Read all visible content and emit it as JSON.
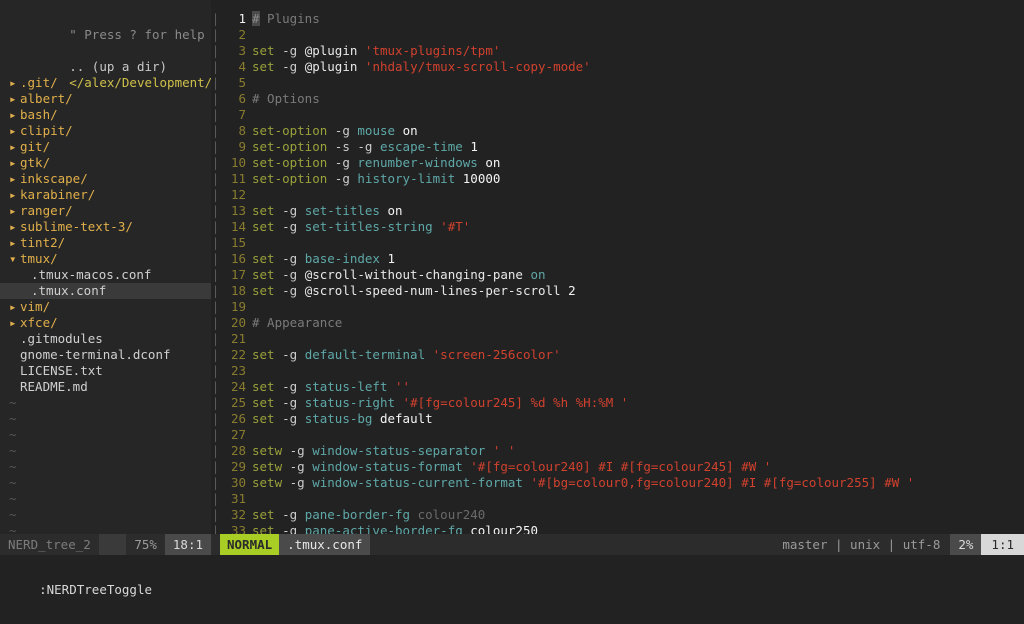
{
  "app": {
    "name": "vim",
    "theme_bg": "#222222",
    "accent": "#a8cd24"
  },
  "sidebar": {
    "name": "NERDTree",
    "help_hint": "\" Press ? for help",
    "up_dir": ".. (up a dir)",
    "cwd": "</alex/Development/dotfiles/",
    "collapsed_icon": "▸",
    "expanded_icon": "▾",
    "items": [
      {
        "label": ".git/",
        "type": "dir",
        "state": "collapsed",
        "indent": 0,
        "selected": false
      },
      {
        "label": "albert/",
        "type": "dir",
        "state": "collapsed",
        "indent": 0,
        "selected": false
      },
      {
        "label": "bash/",
        "type": "dir",
        "state": "collapsed",
        "indent": 0,
        "selected": false
      },
      {
        "label": "clipit/",
        "type": "dir",
        "state": "collapsed",
        "indent": 0,
        "selected": false
      },
      {
        "label": "git/",
        "type": "dir",
        "state": "collapsed",
        "indent": 0,
        "selected": false
      },
      {
        "label": "gtk/",
        "type": "dir",
        "state": "collapsed",
        "indent": 0,
        "selected": false
      },
      {
        "label": "inkscape/",
        "type": "dir",
        "state": "collapsed",
        "indent": 0,
        "selected": false
      },
      {
        "label": "karabiner/",
        "type": "dir",
        "state": "collapsed",
        "indent": 0,
        "selected": false
      },
      {
        "label": "ranger/",
        "type": "dir",
        "state": "collapsed",
        "indent": 0,
        "selected": false
      },
      {
        "label": "sublime-text-3/",
        "type": "dir",
        "state": "collapsed",
        "indent": 0,
        "selected": false
      },
      {
        "label": "tint2/",
        "type": "dir",
        "state": "collapsed",
        "indent": 0,
        "selected": false
      },
      {
        "label": "tmux/",
        "type": "dir",
        "state": "expanded",
        "indent": 0,
        "selected": false
      },
      {
        "label": ".tmux-macos.conf",
        "type": "file",
        "state": "none",
        "indent": 1,
        "selected": false
      },
      {
        "label": ".tmux.conf",
        "type": "file",
        "state": "none",
        "indent": 1,
        "selected": true
      },
      {
        "label": "vim/",
        "type": "dir",
        "state": "collapsed",
        "indent": 0,
        "selected": false
      },
      {
        "label": "xfce/",
        "type": "dir",
        "state": "collapsed",
        "indent": 0,
        "selected": false
      },
      {
        "label": ".gitmodules",
        "type": "file",
        "state": "none",
        "indent": 0,
        "selected": false
      },
      {
        "label": "gnome-terminal.dconf",
        "type": "file",
        "state": "none",
        "indent": 0,
        "selected": false
      },
      {
        "label": "LICENSE.txt",
        "type": "file",
        "state": "none",
        "indent": 0,
        "selected": false
      },
      {
        "label": "README.md",
        "type": "file",
        "state": "none",
        "indent": 0,
        "selected": false
      }
    ],
    "empty_marker": "~",
    "empty_marker_count": 9
  },
  "editor": {
    "filename": ".tmux.conf",
    "cursor_line": 1,
    "lines": [
      {
        "n": 1,
        "tokens": [
          {
            "t": "# Plugins",
            "c": "cmt",
            "cursor": 1
          }
        ]
      },
      {
        "n": 2,
        "tokens": []
      },
      {
        "n": 3,
        "tokens": [
          {
            "t": "set",
            "c": "kw"
          },
          {
            "t": " ",
            "c": "plain"
          },
          {
            "t": "-g",
            "c": "flag"
          },
          {
            "t": " ",
            "c": "plain"
          },
          {
            "t": "@plugin",
            "c": "atvar"
          },
          {
            "t": " ",
            "c": "plain"
          },
          {
            "t": "'tmux-plugins/tpm'",
            "c": "str"
          }
        ]
      },
      {
        "n": 4,
        "tokens": [
          {
            "t": "set",
            "c": "kw"
          },
          {
            "t": " ",
            "c": "plain"
          },
          {
            "t": "-g",
            "c": "flag"
          },
          {
            "t": " ",
            "c": "plain"
          },
          {
            "t": "@plugin",
            "c": "atvar"
          },
          {
            "t": " ",
            "c": "plain"
          },
          {
            "t": "'nhdaly/tmux-scroll-copy-mode'",
            "c": "str"
          }
        ]
      },
      {
        "n": 5,
        "tokens": []
      },
      {
        "n": 6,
        "tokens": [
          {
            "t": "# Options",
            "c": "cmt"
          }
        ]
      },
      {
        "n": 7,
        "tokens": []
      },
      {
        "n": 8,
        "tokens": [
          {
            "t": "set-option",
            "c": "kw"
          },
          {
            "t": " ",
            "c": "plain"
          },
          {
            "t": "-g",
            "c": "flag"
          },
          {
            "t": " ",
            "c": "plain"
          },
          {
            "t": "mouse",
            "c": "opt"
          },
          {
            "t": " ",
            "c": "plain"
          },
          {
            "t": "on",
            "c": "val"
          }
        ]
      },
      {
        "n": 9,
        "tokens": [
          {
            "t": "set-option",
            "c": "kw"
          },
          {
            "t": " ",
            "c": "plain"
          },
          {
            "t": "-s",
            "c": "flag"
          },
          {
            "t": " ",
            "c": "plain"
          },
          {
            "t": "-g",
            "c": "flag"
          },
          {
            "t": " ",
            "c": "plain"
          },
          {
            "t": "escape-time",
            "c": "opt"
          },
          {
            "t": " ",
            "c": "plain"
          },
          {
            "t": "1",
            "c": "val"
          }
        ]
      },
      {
        "n": 10,
        "tokens": [
          {
            "t": "set-option",
            "c": "kw"
          },
          {
            "t": " ",
            "c": "plain"
          },
          {
            "t": "-g",
            "c": "flag"
          },
          {
            "t": " ",
            "c": "plain"
          },
          {
            "t": "renumber-windows",
            "c": "opt"
          },
          {
            "t": " ",
            "c": "plain"
          },
          {
            "t": "on",
            "c": "val"
          }
        ]
      },
      {
        "n": 11,
        "tokens": [
          {
            "t": "set-option",
            "c": "kw"
          },
          {
            "t": " ",
            "c": "plain"
          },
          {
            "t": "-g",
            "c": "flag"
          },
          {
            "t": " ",
            "c": "plain"
          },
          {
            "t": "history-limit",
            "c": "opt"
          },
          {
            "t": " ",
            "c": "plain"
          },
          {
            "t": "10000",
            "c": "val"
          }
        ]
      },
      {
        "n": 12,
        "tokens": []
      },
      {
        "n": 13,
        "tokens": [
          {
            "t": "set",
            "c": "kw"
          },
          {
            "t": " ",
            "c": "plain"
          },
          {
            "t": "-g",
            "c": "flag"
          },
          {
            "t": " ",
            "c": "plain"
          },
          {
            "t": "set-titles",
            "c": "opt"
          },
          {
            "t": " ",
            "c": "plain"
          },
          {
            "t": "on",
            "c": "val"
          }
        ]
      },
      {
        "n": 14,
        "tokens": [
          {
            "t": "set",
            "c": "kw"
          },
          {
            "t": " ",
            "c": "plain"
          },
          {
            "t": "-g",
            "c": "flag"
          },
          {
            "t": " ",
            "c": "plain"
          },
          {
            "t": "set-titles-string",
            "c": "opt"
          },
          {
            "t": " ",
            "c": "plain"
          },
          {
            "t": "'#T'",
            "c": "str"
          }
        ]
      },
      {
        "n": 15,
        "tokens": []
      },
      {
        "n": 16,
        "tokens": [
          {
            "t": "set",
            "c": "kw"
          },
          {
            "t": " ",
            "c": "plain"
          },
          {
            "t": "-g",
            "c": "flag"
          },
          {
            "t": " ",
            "c": "plain"
          },
          {
            "t": "base-index",
            "c": "opt"
          },
          {
            "t": " ",
            "c": "plain"
          },
          {
            "t": "1",
            "c": "val"
          }
        ]
      },
      {
        "n": 17,
        "tokens": [
          {
            "t": "set",
            "c": "kw"
          },
          {
            "t": " ",
            "c": "plain"
          },
          {
            "t": "-g",
            "c": "flag"
          },
          {
            "t": " ",
            "c": "plain"
          },
          {
            "t": "@scroll-without-changing-pane",
            "c": "atvar"
          },
          {
            "t": " ",
            "c": "plain"
          },
          {
            "t": "on",
            "c": "opt"
          }
        ]
      },
      {
        "n": 18,
        "tokens": [
          {
            "t": "set",
            "c": "kw"
          },
          {
            "t": " ",
            "c": "plain"
          },
          {
            "t": "-g",
            "c": "flag"
          },
          {
            "t": " ",
            "c": "plain"
          },
          {
            "t": "@scroll-speed-num-lines-per-scroll",
            "c": "atvar"
          },
          {
            "t": " ",
            "c": "plain"
          },
          {
            "t": "2",
            "c": "val"
          }
        ]
      },
      {
        "n": 19,
        "tokens": []
      },
      {
        "n": 20,
        "tokens": [
          {
            "t": "# Appearance",
            "c": "cmt"
          }
        ]
      },
      {
        "n": 21,
        "tokens": []
      },
      {
        "n": 22,
        "tokens": [
          {
            "t": "set",
            "c": "kw"
          },
          {
            "t": " ",
            "c": "plain"
          },
          {
            "t": "-g",
            "c": "flag"
          },
          {
            "t": " ",
            "c": "plain"
          },
          {
            "t": "default-terminal",
            "c": "opt"
          },
          {
            "t": " ",
            "c": "plain"
          },
          {
            "t": "'screen-256color'",
            "c": "str"
          }
        ]
      },
      {
        "n": 23,
        "tokens": []
      },
      {
        "n": 24,
        "tokens": [
          {
            "t": "set",
            "c": "kw"
          },
          {
            "t": " ",
            "c": "plain"
          },
          {
            "t": "-g",
            "c": "flag"
          },
          {
            "t": " ",
            "c": "plain"
          },
          {
            "t": "status-left",
            "c": "opt"
          },
          {
            "t": " ",
            "c": "plain"
          },
          {
            "t": "''",
            "c": "str"
          }
        ]
      },
      {
        "n": 25,
        "tokens": [
          {
            "t": "set",
            "c": "kw"
          },
          {
            "t": " ",
            "c": "plain"
          },
          {
            "t": "-g",
            "c": "flag"
          },
          {
            "t": " ",
            "c": "plain"
          },
          {
            "t": "status-right",
            "c": "opt"
          },
          {
            "t": " ",
            "c": "plain"
          },
          {
            "t": "'#[fg=colour245] %d %h %H:%M '",
            "c": "str"
          }
        ]
      },
      {
        "n": 26,
        "tokens": [
          {
            "t": "set",
            "c": "kw"
          },
          {
            "t": " ",
            "c": "plain"
          },
          {
            "t": "-g",
            "c": "flag"
          },
          {
            "t": " ",
            "c": "plain"
          },
          {
            "t": "status-bg",
            "c": "opt"
          },
          {
            "t": " ",
            "c": "plain"
          },
          {
            "t": "default",
            "c": "val"
          }
        ]
      },
      {
        "n": 27,
        "tokens": []
      },
      {
        "n": 28,
        "tokens": [
          {
            "t": "setw",
            "c": "kw"
          },
          {
            "t": " ",
            "c": "plain"
          },
          {
            "t": "-g",
            "c": "flag"
          },
          {
            "t": " ",
            "c": "plain"
          },
          {
            "t": "window-status-separator",
            "c": "opt"
          },
          {
            "t": " ",
            "c": "plain"
          },
          {
            "t": "' '",
            "c": "str"
          }
        ]
      },
      {
        "n": 29,
        "tokens": [
          {
            "t": "setw",
            "c": "kw"
          },
          {
            "t": " ",
            "c": "plain"
          },
          {
            "t": "-g",
            "c": "flag"
          },
          {
            "t": " ",
            "c": "plain"
          },
          {
            "t": "window-status-format",
            "c": "opt"
          },
          {
            "t": " ",
            "c": "plain"
          },
          {
            "t": "'#[fg=colour240] #I #[fg=colour245] #W '",
            "c": "str"
          }
        ]
      },
      {
        "n": 30,
        "tokens": [
          {
            "t": "setw",
            "c": "kw"
          },
          {
            "t": " ",
            "c": "plain"
          },
          {
            "t": "-g",
            "c": "flag"
          },
          {
            "t": " ",
            "c": "plain"
          },
          {
            "t": "window-status-current-format",
            "c": "opt"
          },
          {
            "t": " ",
            "c": "plain"
          },
          {
            "t": "'#[bg=colour0,fg=colour240] #I #[fg=colour255] #W '",
            "c": "str"
          }
        ]
      },
      {
        "n": 31,
        "tokens": []
      },
      {
        "n": 32,
        "tokens": [
          {
            "t": "set",
            "c": "kw"
          },
          {
            "t": " ",
            "c": "plain"
          },
          {
            "t": "-g",
            "c": "flag"
          },
          {
            "t": " ",
            "c": "plain"
          },
          {
            "t": "pane-border-fg",
            "c": "opt"
          },
          {
            "t": " ",
            "c": "plain"
          },
          {
            "t": "colour240",
            "c": "dim"
          }
        ]
      },
      {
        "n": 33,
        "tokens": [
          {
            "t": "set",
            "c": "kw"
          },
          {
            "t": " ",
            "c": "plain"
          },
          {
            "t": "-g",
            "c": "flag"
          },
          {
            "t": " ",
            "c": "plain"
          },
          {
            "t": "pane-active-border-fg",
            "c": "opt"
          },
          {
            "t": " ",
            "c": "plain"
          },
          {
            "t": "colour250",
            "c": "val"
          }
        ]
      }
    ]
  },
  "statusbar": {
    "nerdtree_buffer": "NERD_tree_2",
    "nerdtree_percent": "75%",
    "nerdtree_position": "18:1",
    "mode": "NORMAL",
    "file": ".tmux.conf",
    "branch": "master",
    "fileformat": "unix",
    "encoding": "utf-8",
    "percent": "2%",
    "position": "1:1",
    "separator": "|"
  },
  "cmdline": {
    "text": ":NERDTreeToggle"
  }
}
